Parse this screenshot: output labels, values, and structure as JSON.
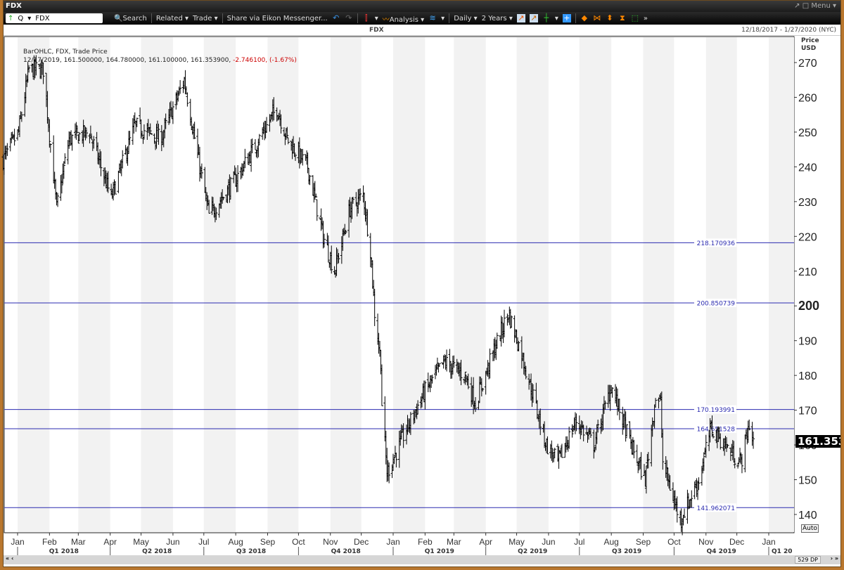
{
  "window": {
    "title": "FDX",
    "menu": "Menu"
  },
  "toolbar": {
    "ric": "FDX",
    "quote_label": "Q",
    "search": "Search",
    "related": "Related",
    "trade": "Trade",
    "share": "Share via Eikon Messenger...",
    "analysis": "Analysis",
    "interval": "Daily",
    "range": "2 Years"
  },
  "header": {
    "title": "FDX",
    "date_range": "12/18/2017 - 1/27/2020 (NYC)"
  },
  "legend": {
    "line1": "BarOHLC, FDX, Trade Price",
    "values": "12/17/2019, 161.500000, 164.780000, 161.100000, 161.353900,",
    "change": "-2.746100, (-1.67%)"
  },
  "axis": {
    "price_label": "Price",
    "currency": "USD",
    "auto": "Auto",
    "last_price": "161.353"
  },
  "scroll": {
    "datapoints": "529 DP"
  },
  "colors": {
    "hline": "#2b2bb0",
    "bar": "#000000",
    "neg": "#cc0000",
    "frame": "#b9772e"
  },
  "chart_data": {
    "type": "ohlc",
    "title": "FDX",
    "ylabel": "Price USD",
    "ylim": [
      136,
      275
    ],
    "yticks": [
      140,
      150,
      160,
      170,
      180,
      190,
      200,
      210,
      220,
      230,
      240,
      250,
      260,
      270
    ],
    "xlim": [
      "2017-12-18",
      "2020-01-27"
    ],
    "month_ticks": [
      {
        "d": "2018-01-01",
        "l": "Jan"
      },
      {
        "d": "2018-02-01",
        "l": "Feb"
      },
      {
        "d": "2018-03-01",
        "l": "Mar"
      },
      {
        "d": "2018-04-01",
        "l": "Apr"
      },
      {
        "d": "2018-05-01",
        "l": "May"
      },
      {
        "d": "2018-06-01",
        "l": "Jun"
      },
      {
        "d": "2018-07-01",
        "l": "Jul"
      },
      {
        "d": "2018-08-01",
        "l": "Aug"
      },
      {
        "d": "2018-09-01",
        "l": "Sep"
      },
      {
        "d": "2018-10-01",
        "l": "Oct"
      },
      {
        "d": "2018-11-01",
        "l": "Nov"
      },
      {
        "d": "2018-12-01",
        "l": "Dec"
      },
      {
        "d": "2019-01-01",
        "l": "Jan"
      },
      {
        "d": "2019-02-01",
        "l": "Feb"
      },
      {
        "d": "2019-03-01",
        "l": "Mar"
      },
      {
        "d": "2019-04-01",
        "l": "Apr"
      },
      {
        "d": "2019-05-01",
        "l": "May"
      },
      {
        "d": "2019-06-01",
        "l": "Jun"
      },
      {
        "d": "2019-07-01",
        "l": "Jul"
      },
      {
        "d": "2019-08-01",
        "l": "Aug"
      },
      {
        "d": "2019-09-01",
        "l": "Sep"
      },
      {
        "d": "2019-10-01",
        "l": "Oct"
      },
      {
        "d": "2019-11-01",
        "l": "Nov"
      },
      {
        "d": "2019-12-01",
        "l": "Dec"
      },
      {
        "d": "2020-01-01",
        "l": "Jan"
      }
    ],
    "quarters": [
      {
        "d": "2018-01-01",
        "l": "Q1 2018"
      },
      {
        "d": "2018-04-01",
        "l": "Q2 2018"
      },
      {
        "d": "2018-07-01",
        "l": "Q3 2018"
      },
      {
        "d": "2018-10-01",
        "l": "Q4 2018"
      },
      {
        "d": "2019-01-01",
        "l": "Q1 2019"
      },
      {
        "d": "2019-04-01",
        "l": "Q2 2019"
      },
      {
        "d": "2019-07-01",
        "l": "Q3 2019"
      },
      {
        "d": "2019-10-01",
        "l": "Q4 2019"
      },
      {
        "d": "2020-01-01",
        "l": "Q1 20"
      }
    ],
    "hlines": [
      {
        "v": 218.170936,
        "l": "218.170936"
      },
      {
        "v": 200.850739,
        "l": "200.850739"
      },
      {
        "v": 170.193991,
        "l": "170.193991"
      },
      {
        "v": 164.651528,
        "l": "164.651528"
      },
      {
        "v": 141.962071,
        "l": "141.962071"
      }
    ],
    "close_path": [
      [
        "2017-12-18",
        242
      ],
      [
        "2018-01-02",
        250
      ],
      [
        "2018-01-12",
        268
      ],
      [
        "2018-01-26",
        268
      ],
      [
        "2018-02-08",
        228
      ],
      [
        "2018-02-20",
        248
      ],
      [
        "2018-03-12",
        250
      ],
      [
        "2018-04-02",
        231
      ],
      [
        "2018-04-25",
        252
      ],
      [
        "2018-05-20",
        248
      ],
      [
        "2018-06-12",
        265
      ],
      [
        "2018-06-27",
        240
      ],
      [
        "2018-07-06",
        226
      ],
      [
        "2018-07-31",
        236
      ],
      [
        "2018-08-20",
        246
      ],
      [
        "2018-09-10",
        257
      ],
      [
        "2018-09-20",
        248
      ],
      [
        "2018-10-10",
        240
      ],
      [
        "2018-10-25",
        220
      ],
      [
        "2018-11-05",
        210
      ],
      [
        "2018-11-20",
        228
      ],
      [
        "2018-12-03",
        232
      ],
      [
        "2018-12-10",
        216
      ],
      [
        "2018-12-14",
        198
      ],
      [
        "2018-12-20",
        184
      ],
      [
        "2018-12-21",
        172
      ],
      [
        "2018-12-26",
        152
      ],
      [
        "2019-01-10",
        162
      ],
      [
        "2019-01-31",
        175
      ],
      [
        "2019-02-20",
        184
      ],
      [
        "2019-03-12",
        180
      ],
      [
        "2019-03-22",
        172
      ],
      [
        "2019-04-10",
        188
      ],
      [
        "2019-04-23",
        198
      ],
      [
        "2019-05-06",
        186
      ],
      [
        "2019-05-30",
        160
      ],
      [
        "2019-06-10",
        155
      ],
      [
        "2019-06-28",
        167
      ],
      [
        "2019-07-15",
        160
      ],
      [
        "2019-08-01",
        177
      ],
      [
        "2019-08-20",
        160
      ],
      [
        "2019-09-03",
        150
      ],
      [
        "2019-09-13",
        174
      ],
      [
        "2019-09-18",
        172
      ],
      [
        "2019-09-20",
        155
      ],
      [
        "2019-10-04",
        141
      ],
      [
        "2019-10-08",
        139
      ],
      [
        "2019-10-25",
        150
      ],
      [
        "2019-11-06",
        165
      ],
      [
        "2019-11-25",
        158
      ],
      [
        "2019-12-05",
        155
      ],
      [
        "2019-12-13",
        166
      ],
      [
        "2019-12-17",
        161.35
      ]
    ]
  }
}
